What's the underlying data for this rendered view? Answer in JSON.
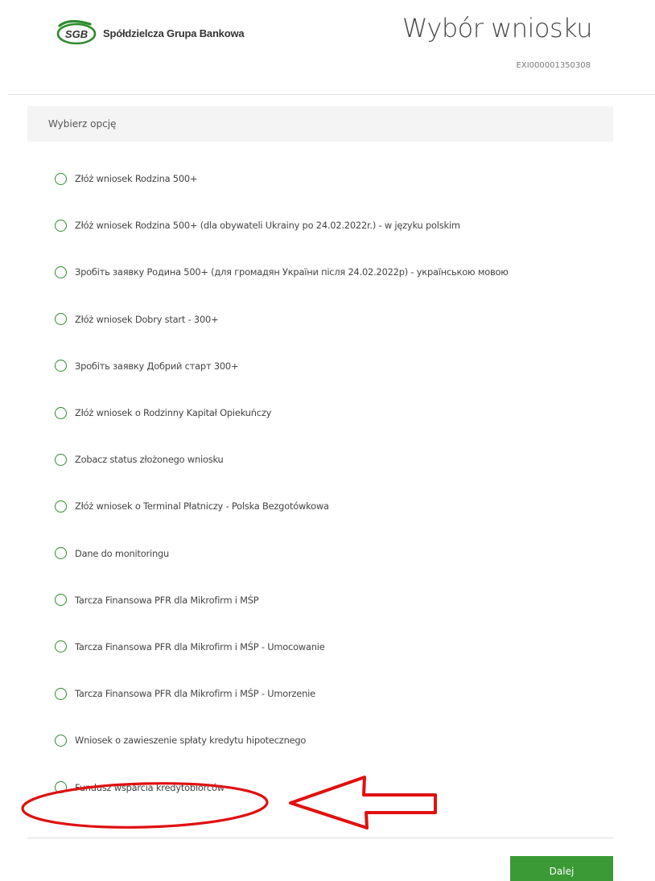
{
  "brand": {
    "logo_text": "SGB",
    "name": "Spółdzielcza Grupa Bankowa",
    "logo_color": "#2e8b2e"
  },
  "header": {
    "title": "Wybór wniosku",
    "request_id": "EXI000001350308"
  },
  "panel": {
    "heading": "Wybierz opcję",
    "options": [
      {
        "label": "Złóż wniosek Rodzina 500+"
      },
      {
        "label": "Złóż wniosek Rodzina 500+ (dla obywateli Ukrainy po 24.02.2022r.) - w języku polskim"
      },
      {
        "label": "Зробіть заявку Родина 500+ (для громадян України після 24.02.2022р) - українською мовою"
      },
      {
        "label": "Złóż wniosek Dobry start - 300+"
      },
      {
        "label": "Зробіть заявку Добрий старт 300+"
      },
      {
        "label": "Złóż wniosek o Rodzinny Kapitał Opiekuńczy"
      },
      {
        "label": "Zobacz status złożonego wniosku"
      },
      {
        "label": "Złóż wniosek o Terminal Płatniczy - Polska Bezgotówkowa"
      },
      {
        "label": "Dane do monitoringu"
      },
      {
        "label": "Tarcza Finansowa PFR dla Mikrofirm i MŚP"
      },
      {
        "label": "Tarcza Finansowa PFR dla Mikrofirm i MŚP - Umocowanie"
      },
      {
        "label": "Tarcza Finansowa PFR dla Mikrofirm i MŚP - Umorzenie"
      },
      {
        "label": "Wniosek o zawieszenie spłaty kredytu hipotecznego"
      },
      {
        "label": "Fundusz wsparcia kredytobiorców"
      }
    ]
  },
  "actions": {
    "next_label": "Dalej"
  },
  "colors": {
    "accent_green": "#3b9a35",
    "annotation_red": "#e01010"
  }
}
